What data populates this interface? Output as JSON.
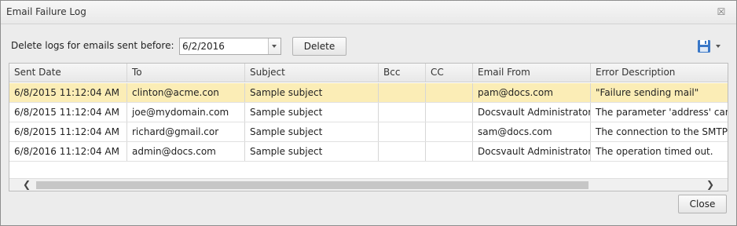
{
  "window": {
    "title": "Email Failure Log",
    "close_glyph": "☒"
  },
  "toolbar": {
    "delete_label_text": "Delete logs for emails sent before:",
    "date_value": "6/2/2016",
    "delete_button": "Delete",
    "save_icon": "save-icon"
  },
  "table": {
    "columns": [
      "Sent Date",
      "To",
      "Subject",
      "Bcc",
      "CC",
      "Email From",
      "Error Description"
    ],
    "rows": [
      [
        "6/8/2015 11:12:04 AM",
        "clinton@acme.con",
        "Sample subject",
        "",
        "",
        "pam@docs.com",
        "\"Failure sending mail\""
      ],
      [
        "6/8/2015 11:12:04 AM",
        "joe@mydomain.com",
        "Sample subject",
        "",
        "",
        "Docsvault Administrator <",
        "The parameter 'address' canno"
      ],
      [
        "6/8/2015 11:12:04 AM",
        "richard@gmail.cor",
        "Sample subject",
        "",
        "",
        "sam@docs.com",
        "The connection to the SMTP"
      ],
      [
        "6/8/2016 11:12:04 AM",
        "admin@docs.com",
        "Sample subject",
        "",
        "",
        "Docsvault Administrator <",
        "The operation timed out."
      ]
    ],
    "selected_row_index": 0,
    "scroll_left_glyph": "❮",
    "scroll_right_glyph": "❯"
  },
  "footer": {
    "close_button": "Close"
  },
  "colors": {
    "selected_row": "#fbedb6",
    "save_icon_blue": "#3a78c8"
  }
}
